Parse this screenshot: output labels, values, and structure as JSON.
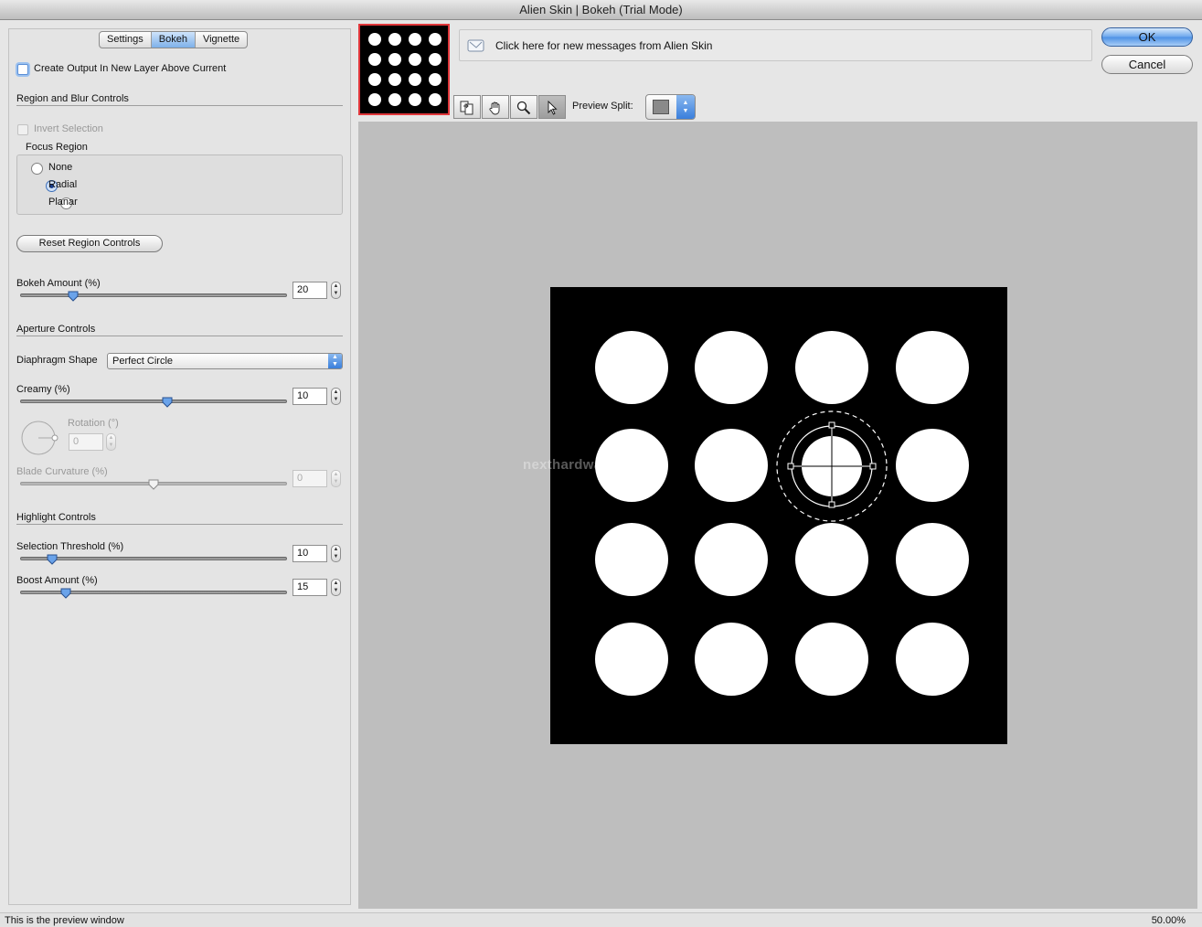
{
  "window": {
    "title": "Alien Skin | Bokeh (Trial Mode)"
  },
  "tabs": [
    {
      "label": "Settings",
      "active": false
    },
    {
      "label": "Bokeh",
      "active": true
    },
    {
      "label": "Vignette",
      "active": false
    }
  ],
  "output": {
    "create_new_layer_label": "Create Output In New Layer Above Current",
    "checked": false
  },
  "region": {
    "section_title": "Region and Blur Controls",
    "invert_selection_label": "Invert Selection",
    "focus_region_title": "Focus Region",
    "options": [
      "None",
      "Radial",
      "Planar"
    ],
    "selected": "Radial",
    "reset_button": "Reset Region Controls"
  },
  "bokeh_amount": {
    "label": "Bokeh Amount (%)",
    "value": "20",
    "level": 0.2
  },
  "aperture": {
    "section_title": "Aperture Controls",
    "diaphragm_label": "Diaphragm Shape",
    "diaphragm_value": "Perfect Circle",
    "creamy_label": "Creamy (%)",
    "creamy_value": "10",
    "creamy_level": 0.55,
    "rotation_label": "Rotation (°)",
    "rotation_value": "0",
    "blade_label": "Blade Curvature (%)",
    "blade_value": "0",
    "blade_level": 0.5
  },
  "highlight": {
    "section_title": "Highlight Controls",
    "threshold_label": "Selection Threshold (%)",
    "threshold_value": "10",
    "threshold_level": 0.12,
    "boost_label": "Boost Amount (%)",
    "boost_value": "15",
    "boost_level": 0.17
  },
  "messages": {
    "text": "Click here for new messages from Alien Skin"
  },
  "buttons": {
    "ok": "OK",
    "cancel": "Cancel"
  },
  "toolbar": {
    "tools": [
      "compare-icon",
      "hand-icon",
      "zoom-icon",
      "pointer-icon"
    ],
    "active_tool": "pointer-icon",
    "preview_split_label": "Preview Split:"
  },
  "preview": {
    "watermark": "nexthardware.com"
  },
  "status": {
    "text": "This is the preview window",
    "zoom": "50.00%"
  }
}
